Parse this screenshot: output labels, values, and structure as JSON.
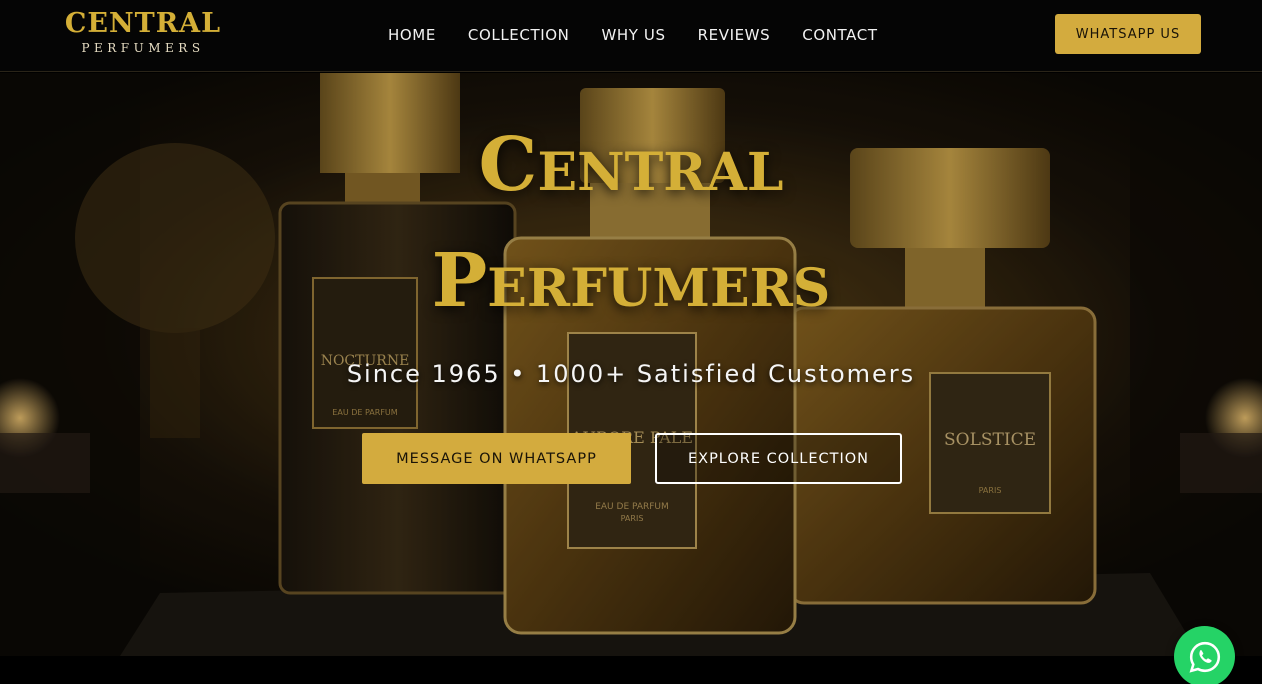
{
  "brand": {
    "name": "CENTRAL",
    "tagline": "PERFUMERS"
  },
  "nav": {
    "links": [
      "HOME",
      "COLLECTION",
      "WHY US",
      "REVIEWS",
      "CONTACT"
    ],
    "cta_label": "WHATSAPP US"
  },
  "hero": {
    "title_line1": "Central",
    "title_line2": "Perfumers",
    "subtitle": "Since 1965 • 1000+ Satisfied Customers",
    "primary_button": "MESSAGE ON WHATSAPP",
    "secondary_button": "EXPLORE COLLECTION",
    "bottle_labels": {
      "left_name": "NOCTURNE",
      "left_type": "EAU DE PARFUM",
      "left_city": "PARIS",
      "center_name": "AURORE PALE",
      "center_type": "EAU DE PARFUM",
      "center_city": "PARIS",
      "right_name": "SOLSTICE",
      "right_city": "PARIS"
    }
  },
  "float_button": {
    "icon": "whatsapp-icon"
  },
  "colors": {
    "gold": "#d4af37",
    "button_gold": "#d3ab3e",
    "nav_background": "#050505",
    "whatsapp_green": "#25d366"
  }
}
